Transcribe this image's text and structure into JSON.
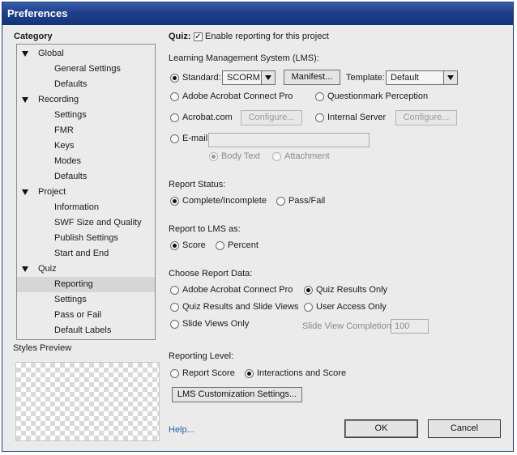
{
  "window": {
    "title": "Preferences"
  },
  "category": {
    "heading": "Category",
    "tree": [
      {
        "label": "Global",
        "level": 0,
        "expanded": true
      },
      {
        "label": "General Settings",
        "level": 1
      },
      {
        "label": "Defaults",
        "level": 1
      },
      {
        "label": "Recording",
        "level": 0,
        "expanded": true
      },
      {
        "label": "Settings",
        "level": 1
      },
      {
        "label": "FMR",
        "level": 1
      },
      {
        "label": "Keys",
        "level": 1
      },
      {
        "label": "Modes",
        "level": 1
      },
      {
        "label": "Defaults",
        "level": 1
      },
      {
        "label": "Project",
        "level": 0,
        "expanded": true
      },
      {
        "label": "Information",
        "level": 1
      },
      {
        "label": "SWF Size and Quality",
        "level": 1
      },
      {
        "label": "Publish Settings",
        "level": 1
      },
      {
        "label": "Start and End",
        "level": 1
      },
      {
        "label": "Quiz",
        "level": 0,
        "expanded": true
      },
      {
        "label": "Reporting",
        "level": 1,
        "selected": true
      },
      {
        "label": "Settings",
        "level": 1
      },
      {
        "label": "Pass or Fail",
        "level": 1
      },
      {
        "label": "Default Labels",
        "level": 1
      }
    ],
    "styles_preview_label": "Styles Preview"
  },
  "quiz": {
    "label": "Quiz:",
    "enable_reporting_label": "Enable reporting for this project",
    "enable_reporting_checked": true
  },
  "lms": {
    "section_label": "Learning Management System (LMS):",
    "standard_label": "Standard:",
    "standard_value": "SCORM",
    "manifest_button": "Manifest...",
    "template_label": "Template:",
    "template_value": "Default",
    "adobe_connect_label": "Adobe Acrobat Connect Pro",
    "questionmark_label": "Questionmark Perception",
    "acrobat_com_label": "Acrobat.com",
    "configure_button_1": "Configure...",
    "internal_server_label": "Internal Server",
    "configure_button_2": "Configure...",
    "email_label": "E-mail:",
    "email_value": "",
    "body_text_label": "Body Text",
    "attachment_label": "Attachment",
    "selected": "Standard",
    "email_format_selected": "Body Text"
  },
  "report_status": {
    "label": "Report Status:",
    "complete_label": "Complete/Incomplete",
    "pass_fail_label": "Pass/Fail",
    "selected": "Complete/Incomplete"
  },
  "report_to_lms": {
    "label": "Report to LMS as:",
    "score_label": "Score",
    "percent_label": "Percent",
    "selected": "Score"
  },
  "report_data": {
    "label": "Choose Report Data:",
    "connect_pro_label": "Adobe Acrobat Connect Pro",
    "quiz_results_only_label": "Quiz Results Only",
    "quiz_results_slide_views_label": "Quiz Results and Slide Views",
    "user_access_only_label": "User Access Only",
    "slide_views_only_label": "Slide Views Only",
    "slide_view_completion_label": "Slide View Completion",
    "slide_view_completion_value": "100",
    "selected": "Quiz Results Only"
  },
  "reporting_level": {
    "label": "Reporting Level:",
    "report_score_label": "Report Score",
    "interactions_label": "Interactions and Score",
    "selected": "Interactions and Score",
    "lms_customization_button": "LMS Customization Settings..."
  },
  "footer": {
    "help_link": "Help...",
    "ok_button": "OK",
    "cancel_button": "Cancel"
  }
}
